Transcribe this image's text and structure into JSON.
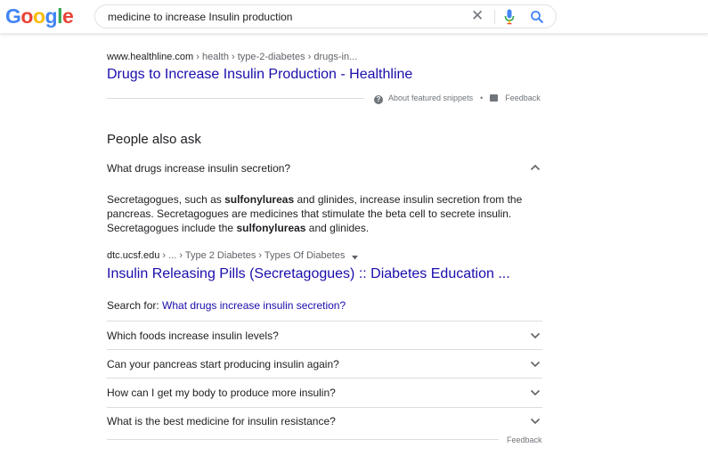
{
  "header": {
    "logo_letters": [
      "G",
      "o",
      "o",
      "g",
      "l",
      "e"
    ],
    "logo_colors": [
      "#4285f4",
      "#ea4335",
      "#fbbc05",
      "#4285f4",
      "#34a853",
      "#ea4335"
    ],
    "search_query": "medicine to increase Insulin production",
    "clear_icon": "close-icon",
    "mic_icon": "microphone-icon",
    "search_icon": "search-icon"
  },
  "featured": {
    "domain": "www.healthline.com",
    "crumbs": " › health › type-2-diabetes › drugs-in...",
    "title": "Drugs to Increase Insulin Production - Healthline",
    "about_label": "About featured snippets",
    "separator": "•",
    "feedback_label": "Feedback"
  },
  "paa": {
    "heading": "People also ask",
    "expanded_question": "What drugs increase insulin secretion?",
    "answer_parts": [
      {
        "text": "Secretagogues, such as ",
        "bold": false
      },
      {
        "text": "sulfonylureas",
        "bold": true
      },
      {
        "text": " and glinides, increase insulin secretion from the pancreas. Secretagogues are medicines that stimulate the beta cell to secrete insulin. Secretagogues include the ",
        "bold": false
      },
      {
        "text": "sulfonylureas",
        "bold": true
      },
      {
        "text": " and glinides.",
        "bold": false
      }
    ],
    "source_domain": "dtc.ucsf.edu",
    "source_crumbs": " › ... › Type 2 Diabetes › Types Of Diabetes",
    "source_title": "Insulin Releasing Pills (Secretagogues) :: Diabetes Education ...",
    "search_for_label": "Search for: ",
    "search_for_link": "What drugs increase insulin secretion?",
    "questions": [
      "Which foods increase insulin levels?",
      "Can your pancreas start producing insulin again?",
      "How can I get my body to produce more insulin?",
      "What is the best medicine for insulin resistance?"
    ],
    "feedback_label": "Feedback"
  },
  "colors": {
    "link": "#1a0dab",
    "muted": "#70757a",
    "divider": "#dadce0"
  }
}
